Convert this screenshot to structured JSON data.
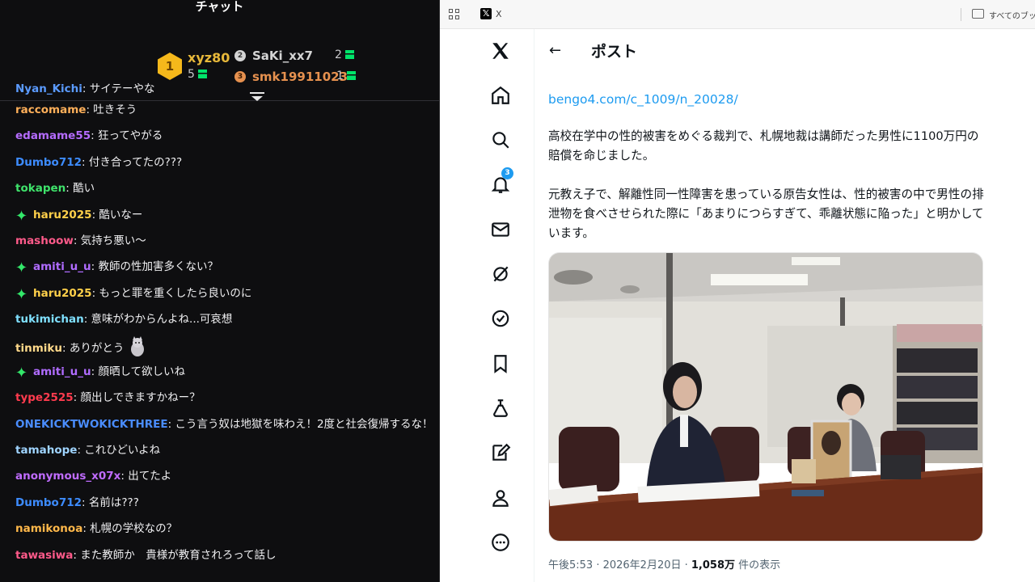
{
  "chat": {
    "header": "チャット",
    "leaderboard": [
      {
        "rank": "1",
        "name": "xyz80",
        "count": "5"
      },
      {
        "rank": "2",
        "name": "SaKi_xx7",
        "count": "2"
      },
      {
        "rank": "3",
        "name": "smk19911023",
        "count": "1"
      }
    ],
    "messages": [
      {
        "user": "Nyan_Kichi",
        "text": "サイテーやな",
        "color": "#5b9bff",
        "badge": false
      },
      {
        "user": "raccomame",
        "text": "吐きそう",
        "color": "#ffb05a",
        "badge": false
      },
      {
        "user": "edamame55",
        "text": "狂ってやがる",
        "color": "#b56cff",
        "badge": false
      },
      {
        "user": "Dumbo712",
        "text": "付き合ってたの???",
        "color": "#3d8cff",
        "badge": false
      },
      {
        "user": "tokapen",
        "text": "酷い",
        "color": "#3fe36b",
        "badge": false
      },
      {
        "user": "haru2025",
        "text": "酷いなー",
        "color": "#ffd04a",
        "badge": true
      },
      {
        "user": "mashoow",
        "text": "気持ち悪い〜",
        "color": "#ff5a8a",
        "badge": false
      },
      {
        "user": "amiti_u_u",
        "text": "教師の性加害多くない？",
        "color": "#b06cff",
        "badge": true
      },
      {
        "user": "haru2025",
        "text": "もっと罪を重くしたら良いのに",
        "color": "#ffd04a",
        "badge": true
      },
      {
        "user": "tukimichan",
        "text": "意味がわからんよね...可哀想",
        "color": "#7fe0ff",
        "badge": false
      },
      {
        "user": "tinmiku",
        "text": "ありがとう",
        "color": "#ffd98a",
        "badge": false,
        "emote": "cat-emote"
      },
      {
        "user": "amiti_u_u",
        "text": "顔晒して欲しいね",
        "color": "#b06cff",
        "badge": true
      },
      {
        "user": "type2525",
        "text": "顔出しできますかねー？",
        "color": "#ff3b4e",
        "badge": false
      },
      {
        "user": "ONEKICKTWOKICKTHREE",
        "text": "こう言う奴は地獄を味わえ！2度と社会復帰するな！",
        "color": "#4a8dff",
        "badge": false
      },
      {
        "user": "tamahope",
        "text": "これひどいよね",
        "color": "#9fd4ff",
        "badge": false
      },
      {
        "user": "anonymous_x07x",
        "text": "出てたよ",
        "color": "#c06cff",
        "badge": false
      },
      {
        "user": "Dumbo712",
        "text": "名前は???",
        "color": "#3d8cff",
        "badge": false
      },
      {
        "user": "namikonoa",
        "text": "札幌の学校なの？",
        "color": "#ffb84a",
        "badge": false
      },
      {
        "user": "tawasiwa",
        "text": "また教師か　貴様が教育されろって話し",
        "color": "#ff5a8a",
        "badge": false
      }
    ]
  },
  "browser": {
    "tab_title": "X",
    "bookmarks_label": "すべてのブック",
    "notification_count": "3",
    "post": {
      "title": "ポスト",
      "link": "bengo4.com/c_1009/n_20028/",
      "paragraph1": "高校在学中の性的被害をめぐる裁判で、札幌地裁は講師だった男性に1100万円の賠償を命じました。",
      "paragraph2": "元教え子で、解離性同一性障害を患っている原告女性は、性的被害の中で男性の排泄物を食べさせられた際に「あまりにつらすぎて、乖離状態に陥った」と明かしています。",
      "time": "午後5:53 · 2026年2月20日 · ",
      "views": "1,058万",
      "views_suffix": " 件の表示"
    }
  },
  "colors": {
    "x_blue": "#1d9bf0",
    "chat_bg": "#0e0e10",
    "gift_green": "#00e46a",
    "gold": "#f5b81b"
  }
}
